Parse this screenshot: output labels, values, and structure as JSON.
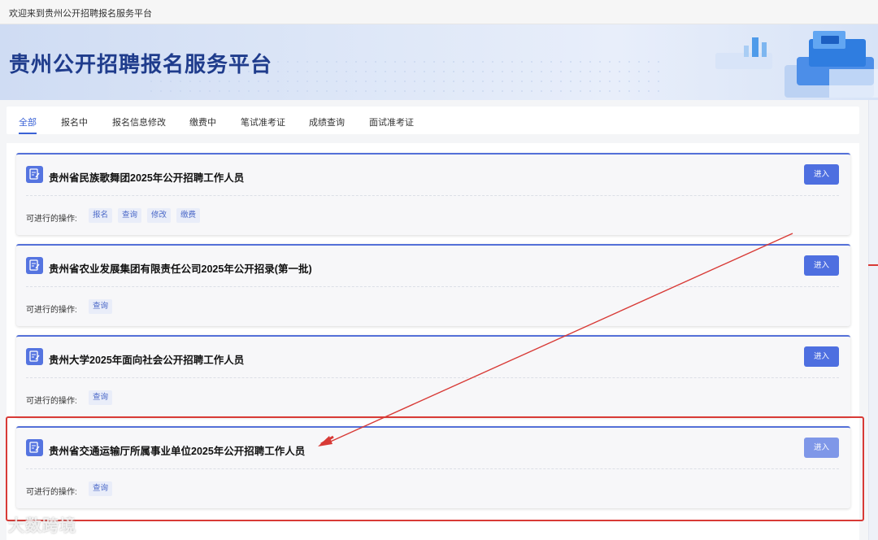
{
  "topbar": {
    "welcome": "欢迎来到贵州公开招聘报名服务平台"
  },
  "banner": {
    "title": "贵州公开招聘报名服务平台"
  },
  "tabs": [
    {
      "label": "全部",
      "active": true
    },
    {
      "label": "报名中",
      "active": false
    },
    {
      "label": "报名信息修改",
      "active": false
    },
    {
      "label": "缴费中",
      "active": false
    },
    {
      "label": "笔试准考证",
      "active": false
    },
    {
      "label": "成绩查询",
      "active": false
    },
    {
      "label": "面试准考证",
      "active": false
    }
  ],
  "cards": [
    {
      "title": "贵州省民族歌舞团2025年公开招聘工作人员",
      "enter_label": "进入",
      "ops_label": "可进行的操作:",
      "ops": [
        "报名",
        "查询",
        "修改",
        "缴费"
      ]
    },
    {
      "title": "贵州省农业发展集团有限责任公司2025年公开招录(第一批)",
      "enter_label": "进入",
      "ops_label": "可进行的操作:",
      "ops": [
        "查询"
      ]
    },
    {
      "title": "贵州大学2025年面向社会公开招聘工作人员",
      "enter_label": "进入",
      "ops_label": "可进行的操作:",
      "ops": [
        "查询"
      ]
    },
    {
      "title": "贵州省交通运输厅所属事业单位2025年公开招聘工作人员",
      "enter_label": "进入",
      "ops_label": "可进行的操作:",
      "ops": [
        "查询"
      ]
    }
  ],
  "annotation": {
    "color": "#d83a36"
  },
  "watermark": {
    "text": "大数跨境"
  },
  "colors": {
    "accent": "#4e6fe0",
    "title": "#1f3c8c",
    "tag_bg": "#e9edf9"
  }
}
